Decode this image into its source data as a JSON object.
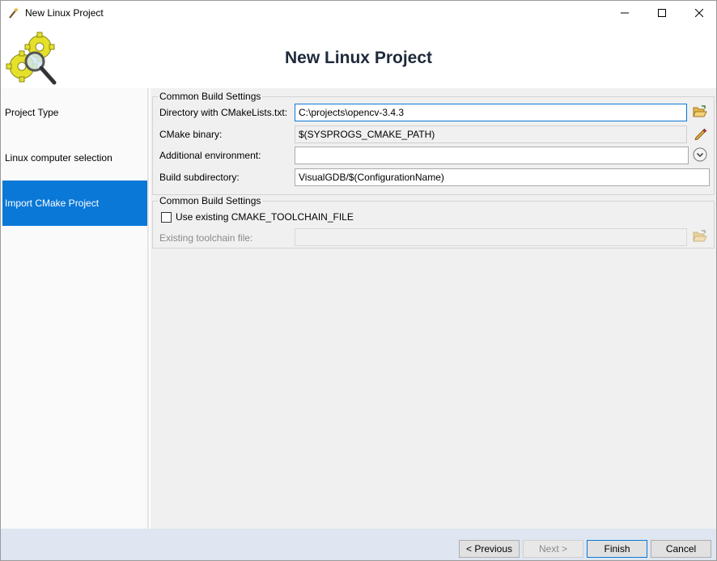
{
  "window": {
    "title": "New Linux Project",
    "icons": {
      "app": "wand-icon",
      "minimize": "minimize-icon",
      "maximize": "maximize-icon",
      "close": "close-icon"
    }
  },
  "header": {
    "title": "New Linux Project",
    "logo": "gears-magnifier-logo"
  },
  "sidebar": {
    "items": [
      {
        "label": "Project Type",
        "active": false
      },
      {
        "label": "Linux computer selection",
        "active": false
      },
      {
        "label": "Import CMake Project",
        "active": true
      }
    ]
  },
  "build_settings": {
    "legend": "Common Build Settings",
    "cmakelists_label": "Directory with CMakeLists.txt:",
    "cmakelists_value": "C:\\projects\\opencv-3.4.3",
    "cmake_binary_label": "CMake binary:",
    "cmake_binary_value": "$(SYSPROGS_CMAKE_PATH)",
    "additional_env_label": "Additional environment:",
    "additional_env_value": "",
    "build_subdir_label": "Build subdirectory:",
    "build_subdir_value": "VisualGDB/$(ConfigurationName)"
  },
  "toolchain_settings": {
    "legend": "Common Build Settings",
    "use_existing_label": "Use existing CMAKE_TOOLCHAIN_FILE",
    "use_existing_checked": false,
    "existing_file_label": "Existing toolchain file:",
    "existing_file_value": ""
  },
  "footer": {
    "previous_label": "< Previous",
    "next_label": "Next >",
    "finish_label": "Finish",
    "cancel_label": "Cancel"
  },
  "colors": {
    "accent": "#0a78d7",
    "footer_bg": "#dfe6f1",
    "panel_bg": "#f0f0f0",
    "folder": "#e8b84a"
  }
}
